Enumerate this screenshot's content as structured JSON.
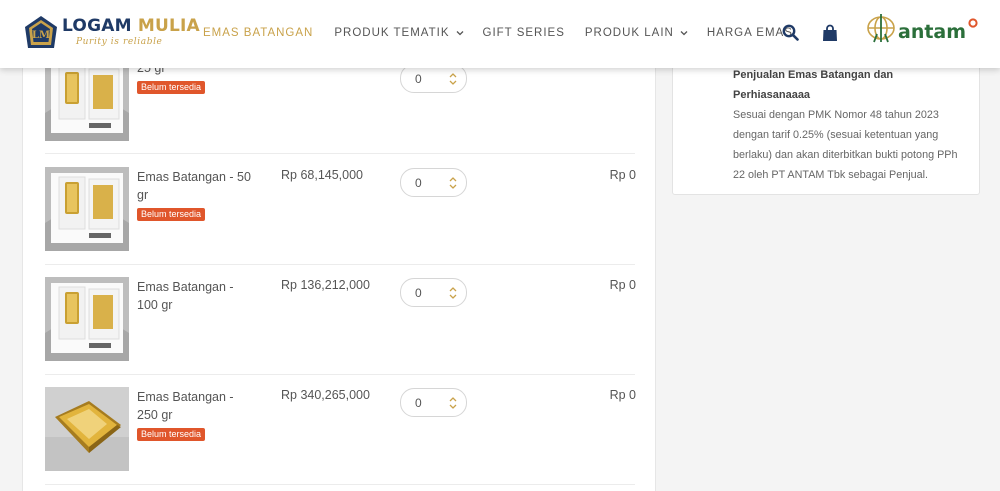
{
  "brand": {
    "name_part1": "LOGAM ",
    "name_part2": "MULIA",
    "tagline": "Purity is reliable",
    "partner": "antam"
  },
  "nav": {
    "items": [
      {
        "label": "EMAS BATANGAN",
        "active": true
      },
      {
        "label": "PRODUK TEMATIK",
        "dropdown": true
      },
      {
        "label": "GIFT SERIES"
      },
      {
        "label": "PRODUK LAIN",
        "dropdown": true
      },
      {
        "label": "HARGA EMAS"
      }
    ]
  },
  "icons": {
    "search": "search-icon",
    "cart": "shopping-bag-icon"
  },
  "colors": {
    "gold": "#c9a24a",
    "navy": "#1f3a66",
    "badge": "#e0562b",
    "antam_green": "#2b6f3a"
  },
  "products": [
    {
      "name": "25 gr",
      "price": "",
      "qty": "0",
      "total": "",
      "badge": "Belum tersedia",
      "image": "minted-bar"
    },
    {
      "name": "Emas Batangan - 50 gr",
      "price": "Rp 68,145,000",
      "qty": "0",
      "total": "Rp 0",
      "badge": "Belum tersedia",
      "image": "minted-bar"
    },
    {
      "name": "Emas Batangan - 100 gr",
      "price": "Rp 136,212,000",
      "qty": "0",
      "total": "Rp 0",
      "badge": "",
      "image": "minted-bar"
    },
    {
      "name": "Emas Batangan - 250 gr",
      "price": "Rp 340,265,000",
      "qty": "0",
      "total": "Rp 0",
      "badge": "Belum tersedia",
      "image": "cast-bar"
    }
  ],
  "side_info": {
    "title": "Penjualan Emas Batangan dan Perhiasanaaaa",
    "body": "Sesuai dengan PMK Nomor 48 tahun 2023 dengan tarif 0.25% (sesuai ketentuan yang berlaku) dan akan diterbitkan bukti potong PPh 22 oleh PT ANTAM Tbk sebagai Penjual."
  }
}
